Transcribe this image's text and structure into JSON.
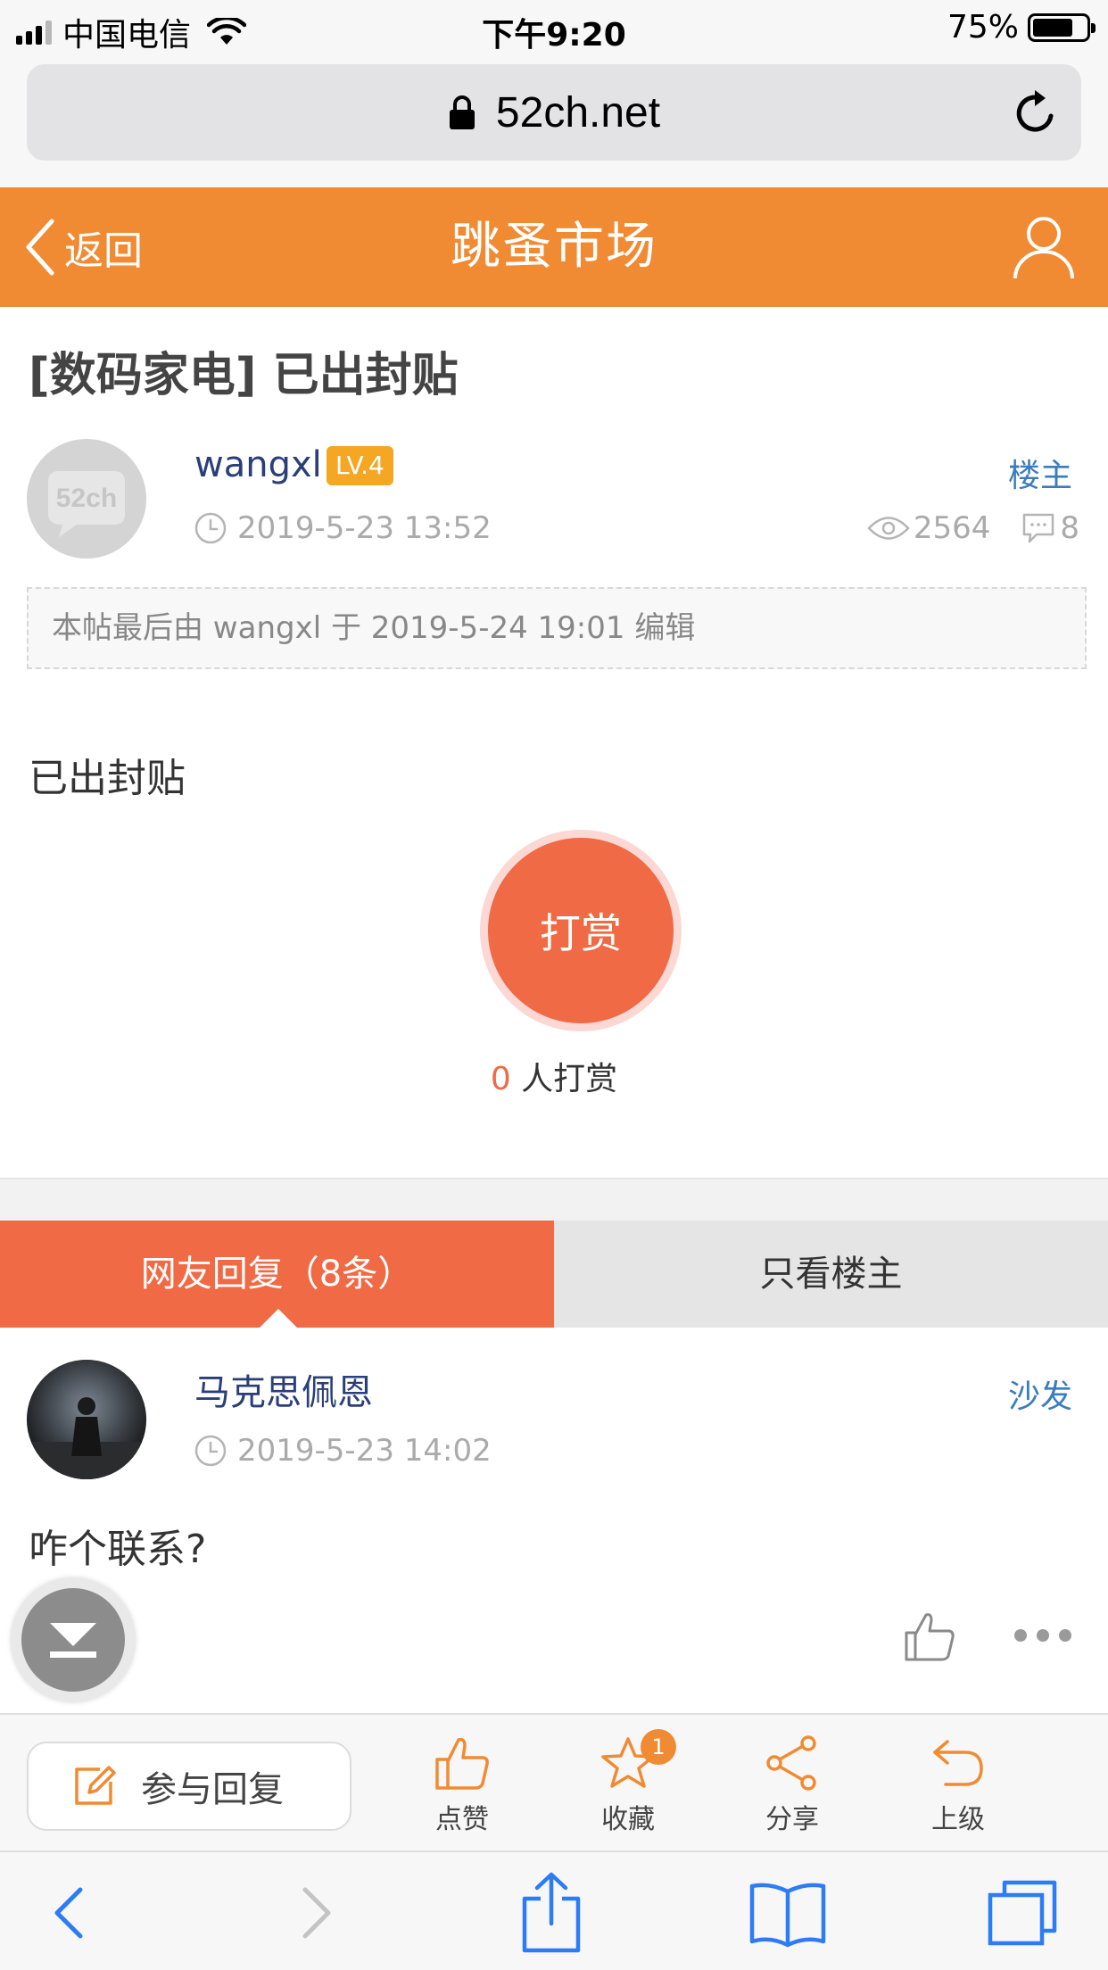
{
  "status_bar": {
    "carrier": "中国电信",
    "time": "下午9:20",
    "battery": "75%",
    "battery_level": 0.75
  },
  "browser": {
    "url": "52ch.net"
  },
  "header": {
    "back_label": "返回",
    "title": "跳蚤市场"
  },
  "post": {
    "title": "[数码家电] 已出封贴",
    "avatar_text": "52ch",
    "author": "wangxl",
    "level": "LV.4",
    "role": "楼主",
    "datetime": "2019-5-23 13:52",
    "views": "2564",
    "comments": "8",
    "edit_note": "本帖最后由 wangxl 于 2019-5-24 19:01 编辑",
    "body": "已出封贴",
    "reward_label": "打赏",
    "reward_count": "0",
    "reward_suffix": " 人打赏"
  },
  "tabs": [
    {
      "label": "网友回复（8条）",
      "active": true
    },
    {
      "label": "只看楼主",
      "active": false
    }
  ],
  "reply": {
    "author": "马克思佩恩",
    "floor": "沙发",
    "datetime": "2019-5-23 14:02",
    "text": "咋个联系?"
  },
  "action_bar": {
    "reply_label": "参与回复",
    "like_label": "点赞",
    "favorite_label": "收藏",
    "favorite_badge": "1",
    "share_label": "分享",
    "up_label": "上级"
  },
  "colors": {
    "header_orange": "#f08b33",
    "accent_red": "#ef6a45",
    "link_blue": "#3a7cbd",
    "name_navy": "#2a3e78",
    "ios_blue": "#2d7cf6"
  }
}
